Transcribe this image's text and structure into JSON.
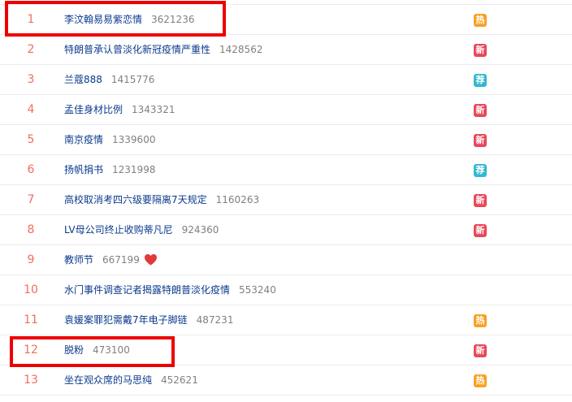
{
  "colors": {
    "rank": "#f26d5f",
    "title_link": "#0b3a8c",
    "count": "#808080",
    "highlight": "#ee0000"
  },
  "badge_types": {
    "hot": {
      "label": "热",
      "color": "#f7a221"
    },
    "new": {
      "label": "新",
      "color": "#e8475a"
    },
    "rec": {
      "label": "荐",
      "color": "#32b8d1"
    }
  },
  "items": [
    {
      "rank": "1",
      "title": "李汶翰易易紫恋情",
      "count": "3621236",
      "badge": "hot",
      "highlighted": true
    },
    {
      "rank": "2",
      "title": "特朗普承认曾淡化新冠疫情严重性",
      "count": "1428562",
      "badge": "new"
    },
    {
      "rank": "3",
      "title": "兰蔻888",
      "count": "1415776",
      "badge": "rec"
    },
    {
      "rank": "4",
      "title": "孟佳身材比例",
      "count": "1343321",
      "badge": "new"
    },
    {
      "rank": "5",
      "title": "南京疫情",
      "count": "1339600",
      "badge": "new"
    },
    {
      "rank": "6",
      "title": "扬帆捐书",
      "count": "1231998",
      "badge": "rec"
    },
    {
      "rank": "7",
      "title": "高校取消考四六级要隔离7天规定",
      "count": "1160263",
      "badge": "new"
    },
    {
      "rank": "8",
      "title": "LV母公司终止收购蒂凡尼",
      "count": "924360",
      "badge": "new"
    },
    {
      "rank": "9",
      "title": "教师节",
      "count": "667199",
      "badge": null,
      "icon": "heart-icon"
    },
    {
      "rank": "10",
      "title": "水门事件调查记者揭露特朗普淡化疫情",
      "count": "553240",
      "badge": null
    },
    {
      "rank": "11",
      "title": "袁媛案罪犯需戴7年电子脚链",
      "count": "487231",
      "badge": "hot"
    },
    {
      "rank": "12",
      "title": "脱粉",
      "count": "473100",
      "badge": "new",
      "highlighted": true
    },
    {
      "rank": "13",
      "title": "坐在观众席的马思纯",
      "count": "452621",
      "badge": "hot"
    }
  ]
}
